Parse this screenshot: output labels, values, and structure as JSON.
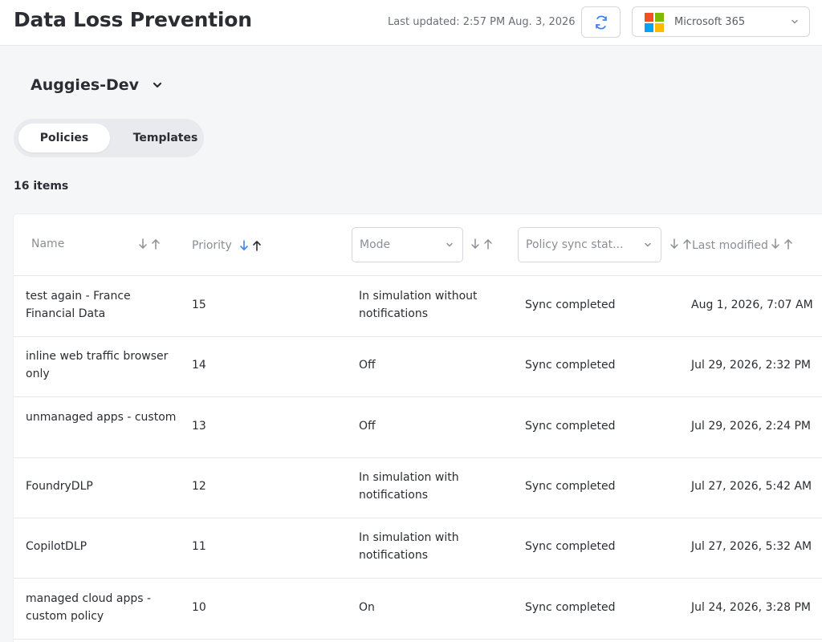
{
  "header": {
    "title": "Data Loss Prevention",
    "last_updated": "Last updated: 2:57 PM Aug. 3, 2026",
    "refresh_icon": "refresh-icon",
    "tenant": "Microsoft 365"
  },
  "workspace": {
    "name": "Auggies-Dev"
  },
  "tabs": [
    {
      "label": "Policies",
      "active": true
    },
    {
      "label": "Templates",
      "active": false
    }
  ],
  "items_count": "16 items",
  "table": {
    "columns": {
      "name": "Name",
      "priority": "Priority",
      "mode": "Mode",
      "sync": "Policy sync stat...",
      "modified": "Last modified"
    },
    "rows": [
      {
        "name": "test again - France Financial Data",
        "priority": "15",
        "mode": "In simulation without notifications",
        "sync": "Sync completed",
        "modified": "Aug 1, 2026, 7:07 AM"
      },
      {
        "name": "inline web traffic browser only",
        "priority": "14",
        "mode": "Off",
        "sync": "Sync completed",
        "modified": "Jul 29, 2026, 2:32 PM"
      },
      {
        "name": "unmanaged apps - custom",
        "priority": "13",
        "mode": "Off",
        "sync": "Sync completed",
        "modified": "Jul 29, 2026, 2:24 PM"
      },
      {
        "name": "FoundryDLP",
        "priority": "12",
        "mode": "In simulation with notifications",
        "sync": "Sync completed",
        "modified": "Jul 27, 2026, 5:42 AM"
      },
      {
        "name": "CopilotDLP",
        "priority": "11",
        "mode": "In simulation with notifications",
        "sync": "Sync completed",
        "modified": "Jul 27, 2026, 5:32 AM"
      },
      {
        "name": "managed cloud apps - custom policy",
        "priority": "10",
        "mode": "On",
        "sync": "Sync completed",
        "modified": "Jul 24, 2026, 3:28 PM"
      }
    ]
  },
  "colors": {
    "accent": "#3b82f6",
    "ms_red": "#f25022",
    "ms_green": "#7fba00",
    "ms_blue": "#00a4ef",
    "ms_yellow": "#ffb900"
  }
}
